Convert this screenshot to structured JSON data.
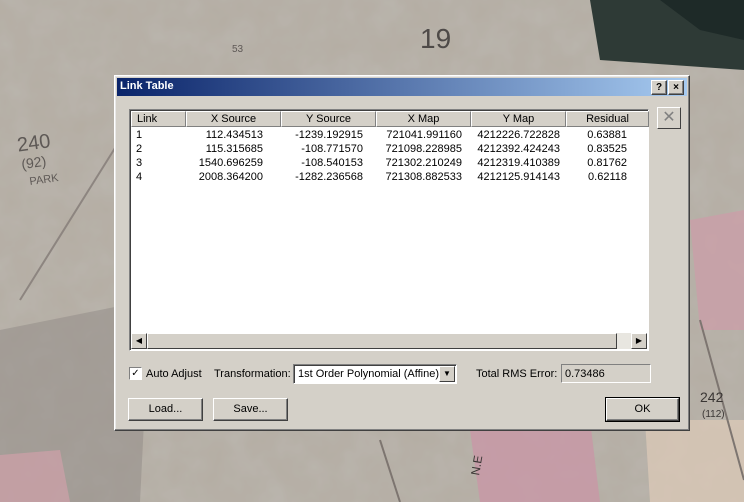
{
  "window": {
    "title": "Link Table",
    "help_glyph": "?",
    "close_glyph": "×"
  },
  "table": {
    "columns": [
      "Link",
      "X Source",
      "Y Source",
      "X Map",
      "Y Map",
      "Residual"
    ],
    "rows": [
      [
        "1",
        "112.434513",
        "-1239.192915",
        "721041.991160",
        "4212226.722828",
        "0.63881"
      ],
      [
        "2",
        "115.315685",
        "-108.771570",
        "721098.228985",
        "4212392.424243",
        "0.83525"
      ],
      [
        "3",
        "1540.696259",
        "-108.540153",
        "721302.210249",
        "4212319.410389",
        "0.81762"
      ],
      [
        "4",
        "2008.364200",
        "-1282.236568",
        "721308.882533",
        "4212125.914143",
        "0.62118"
      ]
    ]
  },
  "scroll": {
    "left_glyph": "◀",
    "right_glyph": "▶"
  },
  "delete_link_glyph": "✕",
  "options": {
    "auto_adjust_label": "Auto Adjust",
    "auto_adjust_checked": true,
    "check_glyph": "✓",
    "transformation_label": "Transformation:",
    "transformation_value": "1st Order Polynomial (Affine)",
    "dropdown_glyph": "▼",
    "rms_label": "Total RMS Error:",
    "rms_value": "0.73486"
  },
  "buttons": {
    "load": "Load...",
    "save": "Save...",
    "ok": "OK"
  },
  "background_labels": {
    "lot_240": "240",
    "lot_92": "(92)",
    "park": "PARK",
    "lot_19": "19",
    "lot_53": "53",
    "lot_242": "242",
    "lot_112": "(112)",
    "ne": "N.E"
  }
}
